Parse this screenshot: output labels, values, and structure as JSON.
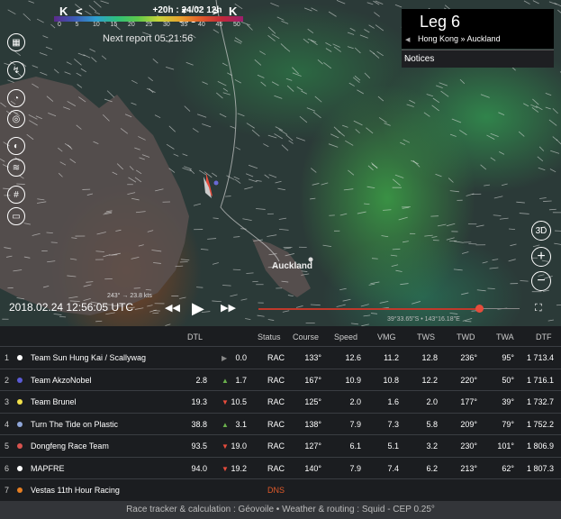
{
  "header": {
    "time_step": "+20h : 24/02 12h UTC",
    "nav": {
      "first": "K",
      "prev": "<",
      "next": ">",
      "last": "K"
    },
    "scale_ticks": [
      "0",
      "5",
      "10",
      "15",
      "20",
      "25",
      "30",
      "35",
      "40",
      "45",
      "50"
    ],
    "next_report": "Next report 05:21:56"
  },
  "leg": {
    "title": "Leg 6",
    "route": "Hong Kong » Auckland",
    "notices": "Notices"
  },
  "map": {
    "place_label": "Auckland",
    "wind_label": "243° → 23.8 kts",
    "coordinates": "39°33.65\"S • 143°16.18\"E",
    "datetime": "2018.02.24 12:56:05 UTC",
    "right_controls": {
      "view3d": "3D"
    }
  },
  "side_icons": [
    "layers-icon",
    "route-icon",
    "compass-icon",
    "target-icon",
    "speed-icon",
    "wind-icon",
    "grid-icon",
    "ruler-icon"
  ],
  "table": {
    "headers": {
      "dtl": "DTL",
      "status": "Status",
      "course": "Course",
      "speed": "Speed",
      "vmg": "VMG",
      "tws": "TWS",
      "twd": "TWD",
      "twa": "TWA",
      "dtf": "DTF"
    },
    "rows": [
      {
        "idx": "1",
        "name": "Team Sun Hung Kai / Scallywag",
        "color": "#ffffff",
        "dtl": "",
        "delta": "0.0",
        "trend": "▶",
        "trend_color": "#888888",
        "status": "RAC",
        "course": "133°",
        "speed": "12.6",
        "vmg": "11.2",
        "tws": "12.8",
        "twd": "236°",
        "twa": "95°",
        "dtf": "1 713.4"
      },
      {
        "idx": "2",
        "name": "Team AkzoNobel",
        "color": "#5b5bd6",
        "dtl": "2.8",
        "delta": "1.7",
        "trend": "▲",
        "trend_color": "#6ab04c",
        "status": "RAC",
        "course": "167°",
        "speed": "10.9",
        "vmg": "10.8",
        "tws": "12.2",
        "twd": "220°",
        "twa": "50°",
        "dtf": "1 716.1"
      },
      {
        "idx": "3",
        "name": "Team Brunel",
        "color": "#f1e04a",
        "dtl": "19.3",
        "delta": "10.5",
        "trend": "▼",
        "trend_color": "#e74c3c",
        "status": "RAC",
        "course": "125°",
        "speed": "2.0",
        "vmg": "1.6",
        "tws": "2.0",
        "twd": "177°",
        "twa": "39°",
        "dtf": "1 732.7"
      },
      {
        "idx": "4",
        "name": "Turn The Tide on Plastic",
        "color": "#8fa6d9",
        "dtl": "38.8",
        "delta": "3.1",
        "trend": "▲",
        "trend_color": "#6ab04c",
        "status": "RAC",
        "course": "138°",
        "speed": "7.9",
        "vmg": "7.3",
        "tws": "5.8",
        "twd": "209°",
        "twa": "79°",
        "dtf": "1 752.2"
      },
      {
        "idx": "5",
        "name": "Dongfeng Race Team",
        "color": "#d9534f",
        "dtl": "93.5",
        "delta": "19.0",
        "trend": "▼",
        "trend_color": "#e74c3c",
        "status": "RAC",
        "course": "127°",
        "speed": "6.1",
        "vmg": "5.1",
        "tws": "3.2",
        "twd": "230°",
        "twa": "101°",
        "dtf": "1 806.9"
      },
      {
        "idx": "6",
        "name": "MAPFRE",
        "color": "#ffffff",
        "dtl": "94.0",
        "delta": "19.2",
        "trend": "▼",
        "trend_color": "#e74c3c",
        "status": "RAC",
        "course": "140°",
        "speed": "7.9",
        "vmg": "7.4",
        "tws": "6.2",
        "twd": "213°",
        "twa": "62°",
        "dtf": "1 807.3"
      },
      {
        "idx": "7",
        "name": "Vestas 11th Hour Racing",
        "color": "#e67e22",
        "dtl": "",
        "delta": "",
        "trend": "",
        "trend_color": "#e74c3c",
        "status": "DNS",
        "course": "",
        "speed": "",
        "vmg": "",
        "tws": "",
        "twd": "",
        "twa": "",
        "dtf": ""
      }
    ]
  },
  "footer": "Race tracker & calculation : Géovoile • Weather & routing : Squid - CEP 0.25°"
}
